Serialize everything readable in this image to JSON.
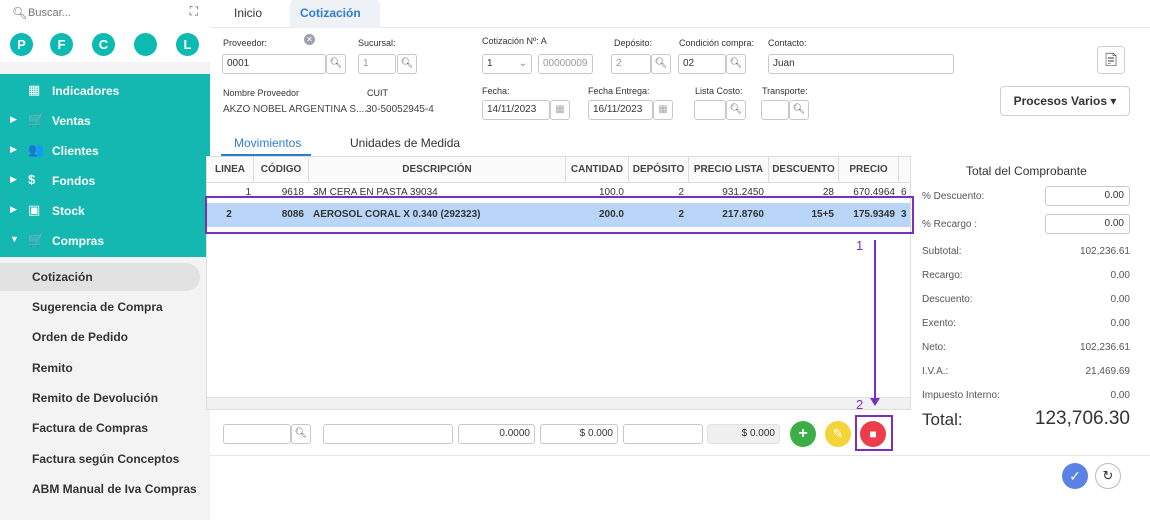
{
  "sidebar": {
    "search_placeholder": "Buscar...",
    "avatars": [
      "P",
      "F",
      "C",
      "",
      "L"
    ],
    "nav": [
      {
        "label": "Indicadores",
        "caret": "",
        "icon": "▦"
      },
      {
        "label": "Ventas",
        "caret": "▶",
        "icon": "🛒"
      },
      {
        "label": "Clientes",
        "caret": "▶",
        "icon": "👥"
      },
      {
        "label": "Fondos",
        "caret": "▶",
        "icon": "$"
      },
      {
        "label": "Stock",
        "caret": "▶",
        "icon": "▣"
      },
      {
        "label": "Compras",
        "caret": "▼",
        "icon": "🛒"
      }
    ],
    "sub_items": [
      "Cotización",
      "Sugerencia de Compra",
      "Orden de Pedido",
      "Remito",
      "Remito de Devolución",
      "Factura de Compras",
      "Factura según Conceptos",
      "ABM Manual de Iva Compras"
    ],
    "accent": "#14b8b0"
  },
  "tabs": {
    "inicio": "Inicio",
    "cotizacion": "Cotización"
  },
  "form": {
    "proveedor_label": "Proveedor:",
    "proveedor_value": "0001",
    "sucursal_label": "Sucursal:",
    "sucursal_value": "1",
    "cotizacion_label": "Cotización Nº: A",
    "cotizacion_select": "1",
    "cotizacion_number": "00000009",
    "deposito_label": "Depósito:",
    "deposito_value": "2",
    "condicion_label": "Condición compra:",
    "condicion_value": "02",
    "contacto_label": "Contacto:",
    "contacto_value": "Juan",
    "nombre_label": "Nombre Proveedor",
    "nombre_value": "AKZO NOBEL ARGENTINA S....",
    "cuit_label": "CUIT",
    "cuit_value": "30-50052945-4",
    "fecha_label": "Fecha:",
    "fecha_value": "14/11/2023",
    "fecha_entrega_label": "Fecha Entrega:",
    "fecha_entrega_value": "16/11/2023",
    "lista_costo_label": "Lista Costo:",
    "transporte_label": "Transporte:",
    "procesos_label": "Procesos Varios"
  },
  "inner_tabs": {
    "movimientos": "Movimientos",
    "unidades": "Unidades de Medida"
  },
  "grid": {
    "headers": [
      "LINEA",
      "CÓDIGO",
      "DESCRIPCIÓN",
      "CANTIDAD",
      "DEPÓSITO",
      "PRECIO LISTA",
      "DESCUENTO",
      "PRECIO"
    ],
    "rows": [
      {
        "linea": "1",
        "codigo": "9618",
        "descripcion": "3M CERA EN PASTA 39034",
        "cantidad": "100.0",
        "deposito": "2",
        "precio_lista": "931.2450",
        "descuento": "28",
        "precio": "670.4964",
        "extra": "6"
      },
      {
        "linea": "2",
        "codigo": "8086",
        "descripcion": "AEROSOL CORAL X 0.340 (292323)",
        "cantidad": "200.0",
        "deposito": "2",
        "precio_lista": "217.8760",
        "descuento": "15+5",
        "precio": "175.9349",
        "extra": "3"
      }
    ]
  },
  "entry": {
    "val1": "0.0000",
    "val2": "$ 0.000",
    "val3": "$ 0.000"
  },
  "totals": {
    "title": "Total del Comprobante",
    "descuento_label": "% Descuento:",
    "descuento_value": "0.00",
    "recargo_label": "% Recargo :",
    "recargo_value": "0.00",
    "rows": [
      {
        "label": "Subtotal:",
        "value": "102,236.61"
      },
      {
        "label": "Recargo:",
        "value": "0.00"
      },
      {
        "label": "Descuento:",
        "value": "0.00"
      },
      {
        "label": "Exento:",
        "value": "0.00"
      },
      {
        "label": "Neto:",
        "value": "102,236.61"
      },
      {
        "label": "I.V.A.:",
        "value": "21,469.69"
      },
      {
        "label": "Impuesto Interno:",
        "value": "0.00"
      }
    ],
    "total_label": "Total:",
    "total_value": "123,706.30"
  },
  "annotations": {
    "step1": "1",
    "step2": "2",
    "color": "#7b2fbf"
  }
}
